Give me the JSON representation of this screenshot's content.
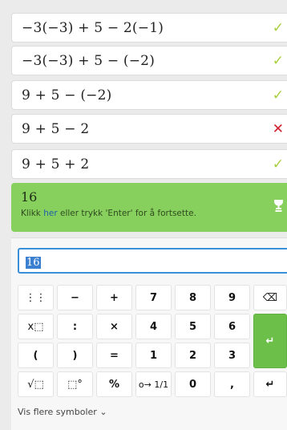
{
  "steps": [
    {
      "expr": "−3(−3) + 5 − 2(−1)",
      "status": "✓"
    },
    {
      "expr": "−3(−3) + 5 − (−2)",
      "status": "✓"
    },
    {
      "expr": "9 + 5 − (−2)",
      "status": "✓"
    },
    {
      "expr": "9 + 5 − 2",
      "status": "✕"
    },
    {
      "expr": "9 + 5 + 2",
      "status": "✓"
    }
  ],
  "result": {
    "value": "16",
    "hint_before": "Klikk ",
    "hint_link": "her",
    "hint_after": " eller trykk 'Enter' for å fortsette."
  },
  "input": {
    "value": "16"
  },
  "keypad": {
    "row1": [
      "⋮⋮",
      "−",
      "+",
      "7",
      "8",
      "9",
      "⌫"
    ],
    "row2": [
      "x⬚",
      ":",
      "×",
      "4",
      "5",
      "6",
      "↵"
    ],
    "row3": [
      "(",
      ")",
      "=",
      "1",
      "2",
      "3"
    ],
    "row4": [
      "√⬚",
      "⬚°",
      "%",
      "o→ 1/1",
      "0",
      ",",
      "↵"
    ]
  },
  "more_symbols": "Vis flere symboler ⌄",
  "colors": {
    "accent_green": "#88d05e",
    "check": "#a8cf3a",
    "cross": "#d0202e",
    "input_border": "#3a8fd8"
  }
}
